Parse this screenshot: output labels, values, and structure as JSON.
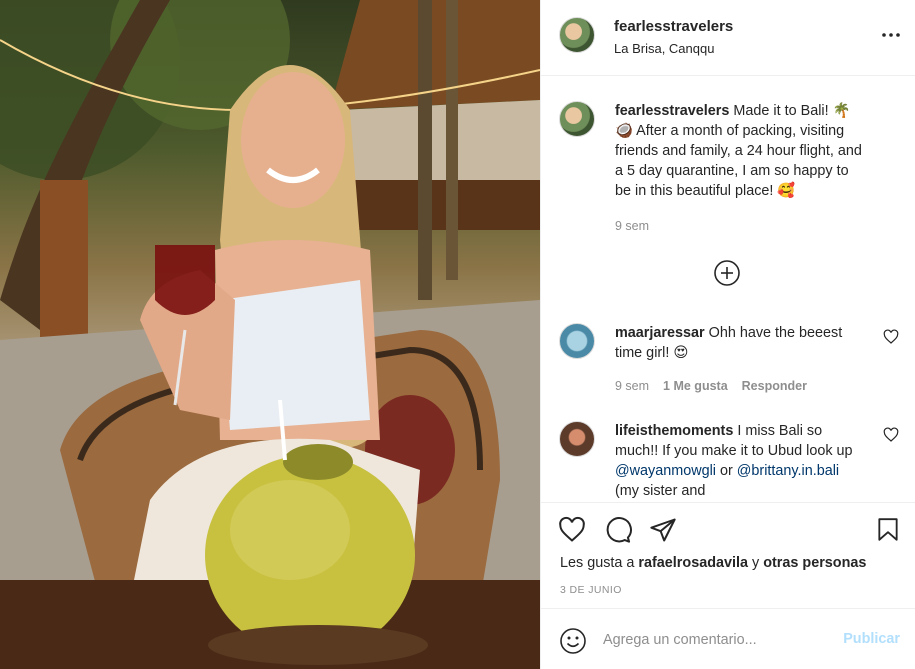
{
  "post": {
    "username": "fearlesstravelers",
    "location": "La Brisa, Canqqu",
    "more_icon": "more-horizontal-icon"
  },
  "caption": {
    "username": "fearlesstravelers",
    "text": "Made it to Bali! 🌴🥥 After a month of packing, visiting friends and family, a 24 hour flight, and a 5 day quarantine, I am so happy to be in this beautiful place! 🥰",
    "time": "9 sem"
  },
  "load_more_icon": "plus-circle-icon",
  "comments": [
    {
      "username": "maarjaressar",
      "text": "Ohh have the beeest time girl! 😍",
      "time": "9 sem",
      "likes": "1 Me gusta",
      "reply": "Responder"
    },
    {
      "username": "lifeisthemoments",
      "text_before": "I miss Bali so much!! If you make it to Ubud look up ",
      "mention1": "@wayanmowgli",
      "text_mid": " or ",
      "mention2": "@brittany.in.bali",
      "text_after": " (my sister and"
    }
  ],
  "actions": {
    "like_icon": "heart-icon",
    "comment_icon": "comment-bubble-icon",
    "share_icon": "paper-plane-icon",
    "save_icon": "bookmark-icon"
  },
  "likes": {
    "prefix": "Les gusta a ",
    "user": "rafaelrosadavila",
    "middle": " y ",
    "others": "otras personas"
  },
  "date": "3 DE JUNIO",
  "add_comment": {
    "placeholder": "Agrega un comentario...",
    "publish_label": "Publicar",
    "emoji_icon": "smiley-face-icon"
  }
}
